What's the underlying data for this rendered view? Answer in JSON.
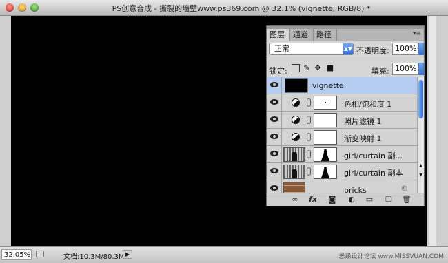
{
  "window": {
    "title": "PS创意合成 - 撕裂的墙壁www.ps369.com @ 32.1% (vignette, RGB/8) *"
  },
  "layers_panel": {
    "tabs": [
      "图层",
      "通道",
      "路径"
    ],
    "menu_glyph": "▾≡",
    "blend_mode": "正常",
    "opacity_label": "不透明度:",
    "opacity_value": "100%",
    "lock_label": "锁定:",
    "fill_label": "填充:",
    "fill_value": "100%",
    "layers": [
      {
        "name": "vignette",
        "selected": true,
        "thumb": "black"
      },
      {
        "name": "色相/饱和度 1",
        "selected": false,
        "thumb": "adjustment"
      },
      {
        "name": "照片滤镜 1",
        "selected": false,
        "thumb": "adjustment"
      },
      {
        "name": "渐变映射 1",
        "selected": false,
        "thumb": "adjustment"
      },
      {
        "name": "girl/curtain 副...",
        "selected": false,
        "thumb": "image"
      },
      {
        "name": "girl/curtain 副本",
        "selected": false,
        "thumb": "image"
      },
      {
        "name": "bricks",
        "selected": false,
        "thumb": "bricks"
      }
    ],
    "toolbar_icons": [
      "link-layers-icon",
      "fx-icon",
      "add-mask-icon",
      "adjustment-layer-icon",
      "new-group-icon",
      "new-layer-icon",
      "trash-icon"
    ]
  },
  "statusbar": {
    "zoom": "32.05%",
    "doc_size": "文档:10.3M/80.3M",
    "watermark": "思缘设计论坛 www.MISSVUAN.COM"
  },
  "colors": {
    "canvas": "#000000",
    "selected_layer": "#b5cdf0",
    "accent_blue": "#2c6fd8"
  }
}
